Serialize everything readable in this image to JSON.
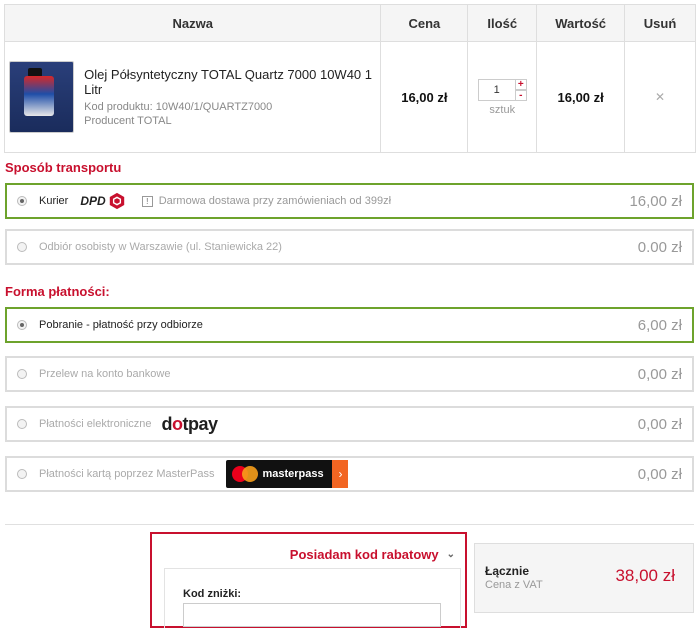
{
  "cart": {
    "headers": {
      "name": "Nazwa",
      "price": "Cena",
      "qty": "Ilość",
      "value": "Wartość",
      "remove": "Usuń"
    },
    "item": {
      "name": "Olej Półsyntetyczny TOTAL Quartz 7000 10W40 1 Litr",
      "code": "Kod produktu: 10W40/1/QUARTZ7000",
      "producer": "Producent TOTAL",
      "price": "16,00 zł",
      "qty": "1",
      "qty_plus": "+",
      "qty_minus": "-",
      "unit": "sztuk",
      "value": "16,00 zł",
      "remove_icon": "✕"
    }
  },
  "transport": {
    "title": "Sposób transportu",
    "options": [
      {
        "label": "Kurier",
        "logo": "DPD",
        "note_icon": "!",
        "note": "Darmowa dostawa przy zamówieniach od 399zł",
        "price": "16,00 zł",
        "selected": true
      },
      {
        "label": "Odbiór osobisty w Warszawie (ul. Staniewicka 22)",
        "price": "0.00 zł",
        "selected": false
      }
    ]
  },
  "payment": {
    "title": "Forma płatności:",
    "options": [
      {
        "label": "Pobranie - płatność przy odbiorze",
        "price": "6,00 zł",
        "selected": true
      },
      {
        "label": "Przelew na konto bankowe",
        "price": "0,00 zł",
        "selected": false
      },
      {
        "label": "Płatności elektroniczne",
        "logo_pre": "d",
        "logo_mid": "o",
        "logo_post": "tpay",
        "price": "0,00 zł",
        "selected": false
      },
      {
        "label": "Płatności kartą poprzez MasterPass",
        "logo": "masterpass",
        "logo_arrow": "›",
        "price": "0,00 zł",
        "selected": false
      }
    ]
  },
  "discount": {
    "toggle": "Posiadam kod rabatowy",
    "chevron": "⌄",
    "label": "Kod zniżki:",
    "value": ""
  },
  "total": {
    "label": "Łącznie",
    "sub": "Cena z VAT",
    "value": "38,00 zł"
  },
  "colors": {
    "accent": "#c8102e",
    "selected_border": "#6da32c"
  }
}
